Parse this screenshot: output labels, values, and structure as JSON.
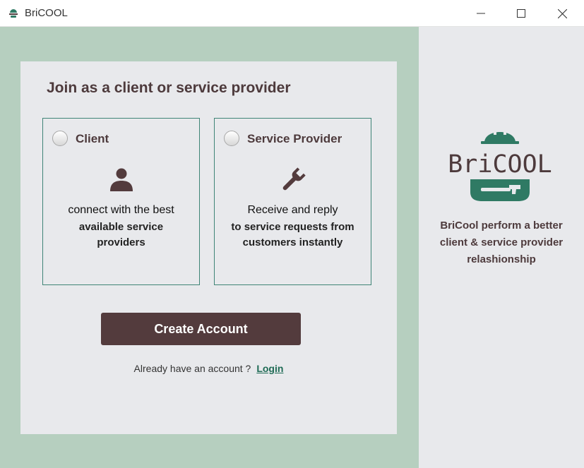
{
  "window": {
    "title": "BriCOOL",
    "icons": [
      "app-icon",
      "minimize-icon",
      "maximize-icon",
      "close-icon"
    ]
  },
  "main": {
    "heading": "Join as a client or service provider",
    "options": [
      {
        "label": "Client",
        "icon": "user-icon",
        "line1": "connect with the best",
        "line2": "available service",
        "line3": "providers"
      },
      {
        "label": "Service Provider",
        "icon": "wrench-icon",
        "line1": "Receive and reply",
        "line2": "to service requests from",
        "line3": "customers instantly"
      }
    ],
    "create_button": "Create Account",
    "login_prompt": "Already have an account ?",
    "login_link": "Login"
  },
  "brand": {
    "logo_text": "BriCOOL",
    "tagline": [
      "BriCool perform a better",
      "client & service provider",
      "relashionship"
    ]
  },
  "colors": {
    "left_panel": "#b6cfbf",
    "card": "#e8e9ec",
    "accent_green": "#2f7a64",
    "button": "#533b3d",
    "text_brown": "#4d3a3c"
  }
}
